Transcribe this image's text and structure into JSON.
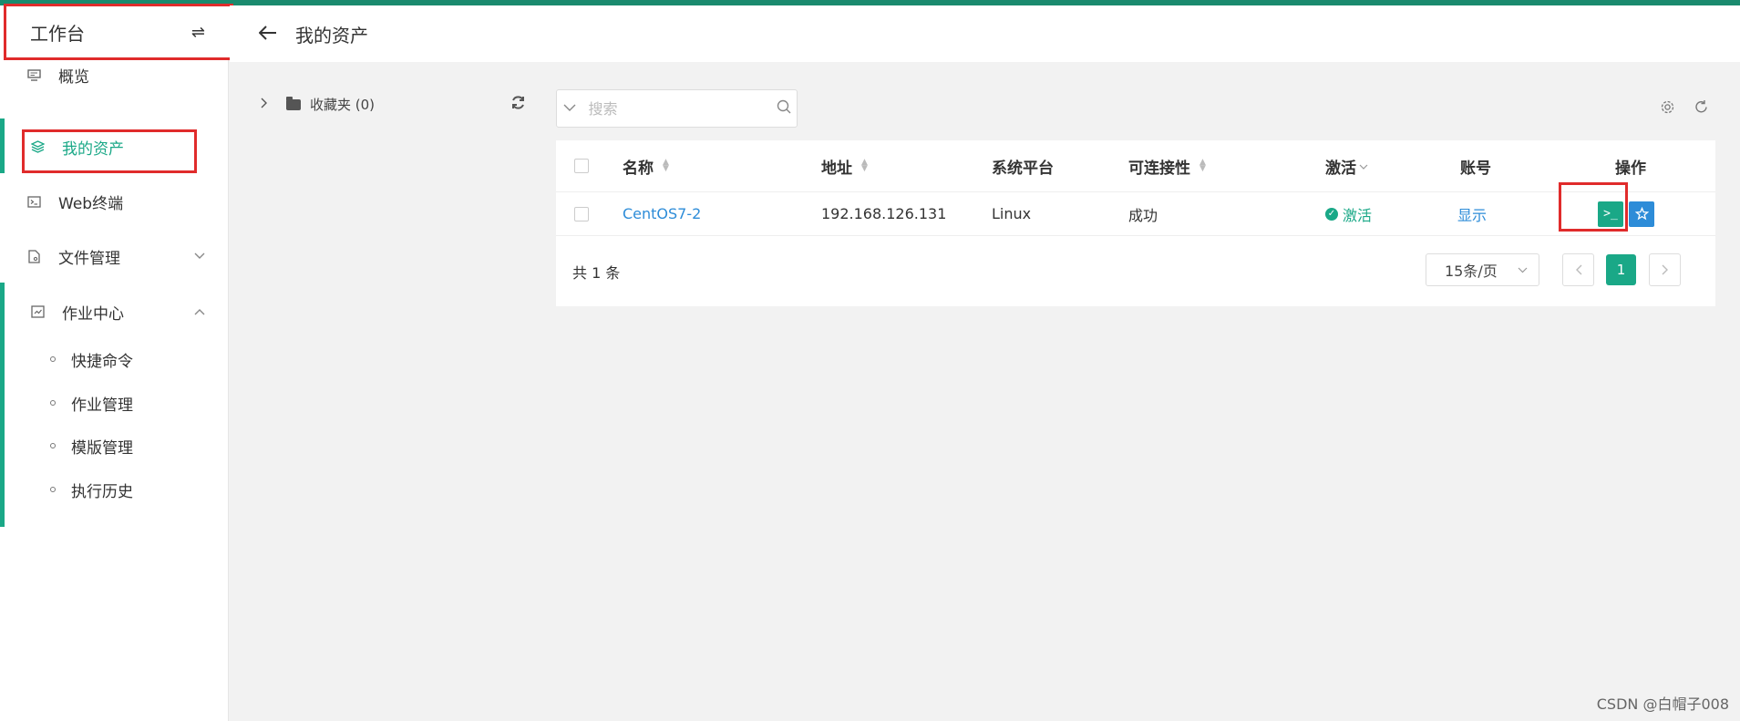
{
  "sidebar": {
    "workspace_title": "工作台",
    "workspace_toggle": "⇌",
    "items": [
      {
        "label": "概览",
        "icon": "monitor-icon"
      },
      {
        "label": "我的资产",
        "icon": "layers-icon"
      },
      {
        "label": "Web终端",
        "icon": "terminal-icon"
      },
      {
        "label": "文件管理",
        "icon": "file-icon"
      },
      {
        "label": "作业中心",
        "icon": "job-icon"
      }
    ],
    "submenu": [
      {
        "label": "快捷命令"
      },
      {
        "label": "作业管理"
      },
      {
        "label": "模版管理"
      },
      {
        "label": "执行历史"
      }
    ]
  },
  "header": {
    "title": "我的资产"
  },
  "tree": {
    "folder_label": "收藏夹 (0)"
  },
  "search": {
    "placeholder": "搜索"
  },
  "table": {
    "columns": {
      "name": "名称",
      "address": "地址",
      "platform": "系统平台",
      "connectivity": "可连接性",
      "activation": "激活",
      "account": "账号",
      "actions": "操作"
    },
    "rows": [
      {
        "name": "CentOS7-2",
        "address": "192.168.126.131",
        "platform": "Linux",
        "connectivity": "成功",
        "activation": "激活",
        "account": "显示"
      }
    ]
  },
  "pagination": {
    "total": "共 1 条",
    "page_size": "15条/页",
    "current": "1"
  },
  "watermark": "CSDN @白帽子008",
  "colors": {
    "accent": "#1aa887",
    "link": "#2d8cd8",
    "highlight": "#e02b2b",
    "top_strip": "#1a8a6e"
  }
}
